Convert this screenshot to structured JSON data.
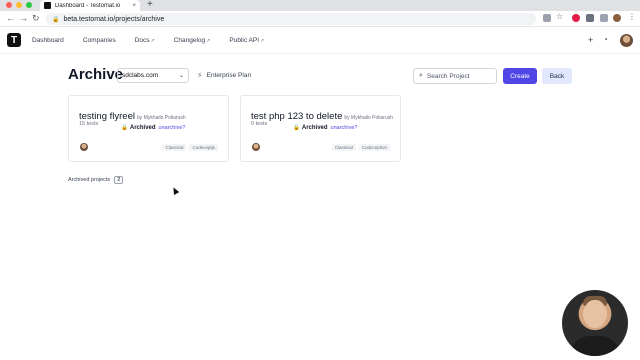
{
  "browser": {
    "tab_title": "Dashboard - Testomat.io",
    "tab_close": "×",
    "new_tab": "+",
    "url": "beta.testomat.io/projects/archive"
  },
  "app": {
    "logo": "T",
    "nav": [
      {
        "label": "Dashboard",
        "external": false
      },
      {
        "label": "Companies",
        "external": false
      },
      {
        "label": "Docs",
        "external": true
      },
      {
        "label": "Changelog",
        "external": true
      },
      {
        "label": "Public API",
        "external": true
      }
    ],
    "external_marker": "↗"
  },
  "page": {
    "title": "Archive",
    "company": "sdclabs.com",
    "plan": "Enterprise Plan",
    "search_placeholder": "Search Project",
    "create_label": "Create",
    "back_label": "Back"
  },
  "projects": [
    {
      "name": "testing flyreel",
      "author": "by Mykhailo Poliarush",
      "tests": "15 tests",
      "archived_label": "Archived",
      "unarchive_label": "unarchive?",
      "tags": [
        "Classical",
        "Codeceptjs"
      ]
    },
    {
      "name": "test php 123 to delete",
      "author": "by Mykhailo Poliarush",
      "tests": "0 tests",
      "archived_label": "Archived",
      "unarchive_label": "unarchive?",
      "tags": [
        "Classical",
        "Codeception"
      ]
    }
  ],
  "footer": {
    "archived_projects_label": "Archived projects",
    "archived_projects_count": "2"
  },
  "colors": {
    "accent": "#4f46e5",
    "back_button_bg": "#e0e7ff",
    "mac_close": "#ff5f57",
    "mac_min": "#febc2e",
    "mac_max": "#28c840"
  }
}
